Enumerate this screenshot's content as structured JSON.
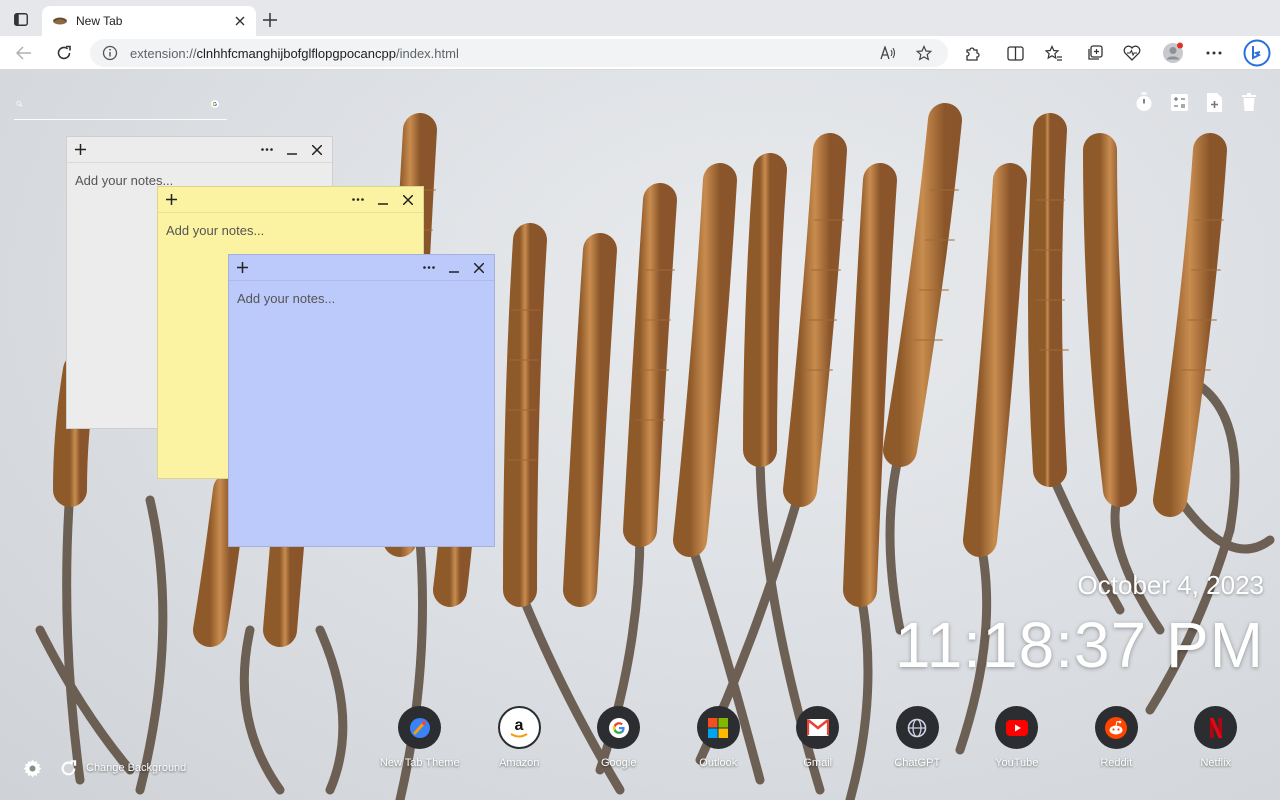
{
  "browser": {
    "tab": {
      "title": "New Tab"
    },
    "url": {
      "prefix": "extension://",
      "host": "clnhhfcmanghijbofglflopgpocancpp",
      "path": "/index.html"
    }
  },
  "search": {
    "placeholder": ""
  },
  "notes": [
    {
      "color": "#ececec",
      "placeholder": "Add your notes..."
    },
    {
      "color": "#fbf3a2",
      "placeholder": "Add your notes..."
    },
    {
      "color": "#bccafb",
      "placeholder": "Add your notes..."
    }
  ],
  "datetime": {
    "date": "October 4, 2023",
    "time": "11:18:37 PM"
  },
  "shortcuts": [
    {
      "label": "New Tab Theme",
      "icon": "new-tab-theme-icon"
    },
    {
      "label": "Amazon",
      "icon": "amazon-icon"
    },
    {
      "label": "Google",
      "icon": "google-icon"
    },
    {
      "label": "Outlook",
      "icon": "outlook-icon"
    },
    {
      "label": "Gmail",
      "icon": "gmail-icon"
    },
    {
      "label": "ChatGPT",
      "icon": "chatgpt-icon"
    },
    {
      "label": "YouTube",
      "icon": "youtube-icon"
    },
    {
      "label": "Reddit",
      "icon": "reddit-icon"
    },
    {
      "label": "Netflix",
      "icon": "netflix-icon"
    }
  ],
  "footer": {
    "change_background_label": "Change Background"
  },
  "colors": {
    "note_gray": "#ececec",
    "note_yellow": "#fbf3a2",
    "note_blue": "#bccafb",
    "shortcut_bg": "#2b2d31"
  }
}
